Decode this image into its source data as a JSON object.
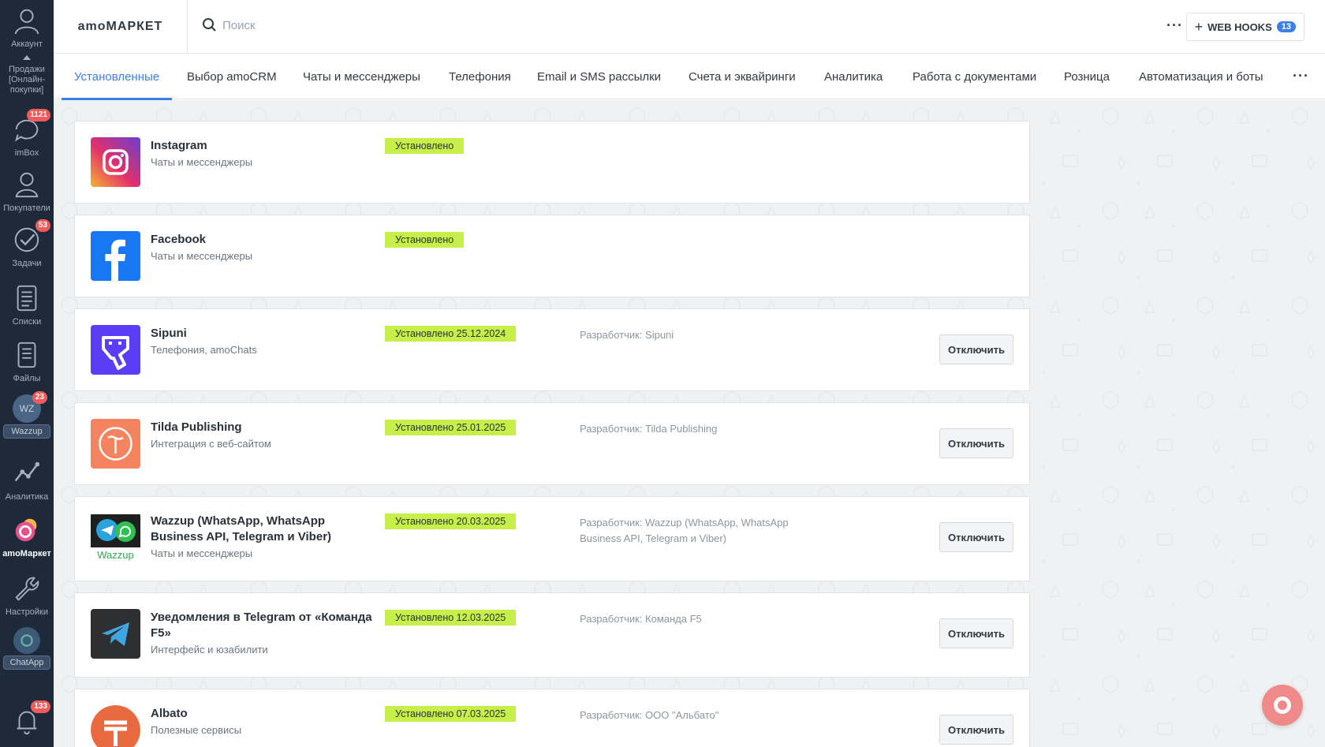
{
  "sidebar": {
    "account": "Аккаунт",
    "sales": "Продажи [Онлайн-покупки]",
    "items": [
      {
        "label": "imBox",
        "badge": "1121"
      },
      {
        "label": "Покупатели",
        "badge": ""
      },
      {
        "label": "Задачи",
        "badge": "53"
      },
      {
        "label": "Списки",
        "badge": ""
      },
      {
        "label": "Файлы",
        "badge": ""
      },
      {
        "label": "WZ",
        "badge": "23",
        "pill": "Wazzup"
      },
      {
        "label": "Аналитика",
        "badge": ""
      },
      {
        "label": "amoМаркет",
        "badge": ""
      },
      {
        "label": "Настройки",
        "badge": ""
      },
      {
        "label": "",
        "badge": "",
        "pill": "ChatApp"
      },
      {
        "label": "",
        "badge": "133"
      }
    ]
  },
  "header": {
    "brand": "amoМАРКЕТ",
    "search_placeholder": "Поиск",
    "more": "···",
    "webhooks_label": "WEB HOOKS",
    "webhooks_count": "13"
  },
  "tabs": [
    {
      "label": "Установленные"
    },
    {
      "label": "Выбор amoCRM"
    },
    {
      "label": "Чаты и мессенджеры"
    },
    {
      "label": "Телефония"
    },
    {
      "label": "Email и SMS рассылки"
    },
    {
      "label": "Счета и эквайринги"
    },
    {
      "label": "Аналитика"
    },
    {
      "label": "Работа с документами"
    },
    {
      "label": "Розница"
    },
    {
      "label": "Автоматизация и боты"
    }
  ],
  "tabs_more": "···",
  "integrations": [
    {
      "name": "Instagram",
      "category": "Чаты и мессенджеры",
      "status": "Установлено",
      "developer": "",
      "action": ""
    },
    {
      "name": "Facebook",
      "category": "Чаты и мессенджеры",
      "status": "Установлено",
      "developer": "",
      "action": ""
    },
    {
      "name": "Sipuni",
      "category": "Телефония, amoChats",
      "status": "Установлено 25.12.2024",
      "developer": "Разработчик: Sipuni",
      "action": "Отключить"
    },
    {
      "name": "Tilda Publishing",
      "category": "Интеграция с веб-сайтом",
      "status": "Установлено 25.01.2025",
      "developer": "Разработчик: Tilda Publishing",
      "action": "Отключить"
    },
    {
      "name": "Wazzup (WhatsApp, WhatsApp Business API, Telegram и Viber)",
      "category": "Чаты и мессенджеры",
      "status": "Установлено 20.03.2025",
      "developer": "Разработчик: Wazzup (WhatsApp, WhatsApp Business API, Telegram и Viber)",
      "action": "Отключить",
      "logo_text": "Wazzup"
    },
    {
      "name": "Уведомления в Telegram от «Команда F5»",
      "category": "Интерфейс и юзабилити",
      "status": "Установлено 12.03.2025",
      "developer": "Разработчик: Команда F5",
      "action": "Отключить"
    },
    {
      "name": "Albato",
      "category": "Полезные сервисы",
      "status": "Установлено 07.03.2025",
      "developer": "Разработчик: ООО \"Альбато\"",
      "action": "Отключить"
    }
  ],
  "colors": {
    "sidebar": "#1e2a3a",
    "accent": "#3c80e6",
    "status_green": "#c6ef4a",
    "badge_red": "#f25b5b"
  }
}
